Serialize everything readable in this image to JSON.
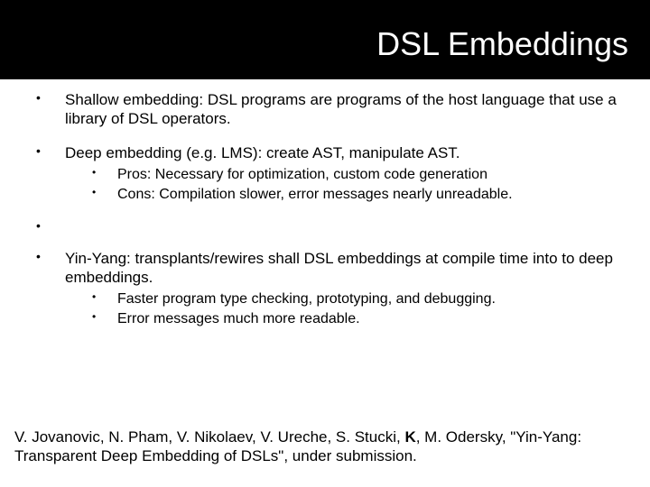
{
  "title": "DSL Embeddings",
  "bullets": {
    "b1": "Shallow embedding: DSL programs are programs of the host language that use a library of DSL operators.",
    "b2": "Deep embedding (e.g. LMS): create AST, manipulate AST.",
    "b2_sub1": "Pros: Necessary for optimization, custom code generation",
    "b2_sub2": "Cons: Compilation slower, error messages nearly unreadable.",
    "b3": "Yin-Yang: transplants/rewires shall DSL embeddings at compile time into to deep embeddings.",
    "b3_sub1": "Faster program type checking, prototyping, and debugging.",
    "b3_sub2": " Error messages much more readable."
  },
  "citation": {
    "pre": "V. Jovanovic, N. Pham, V. Nikolaev, V. Ureche, S. Stucki, ",
    "bold": "K",
    "post": ", M. Odersky, \"Yin-Yang: Transparent Deep Embedding of DSLs\", under submission."
  }
}
